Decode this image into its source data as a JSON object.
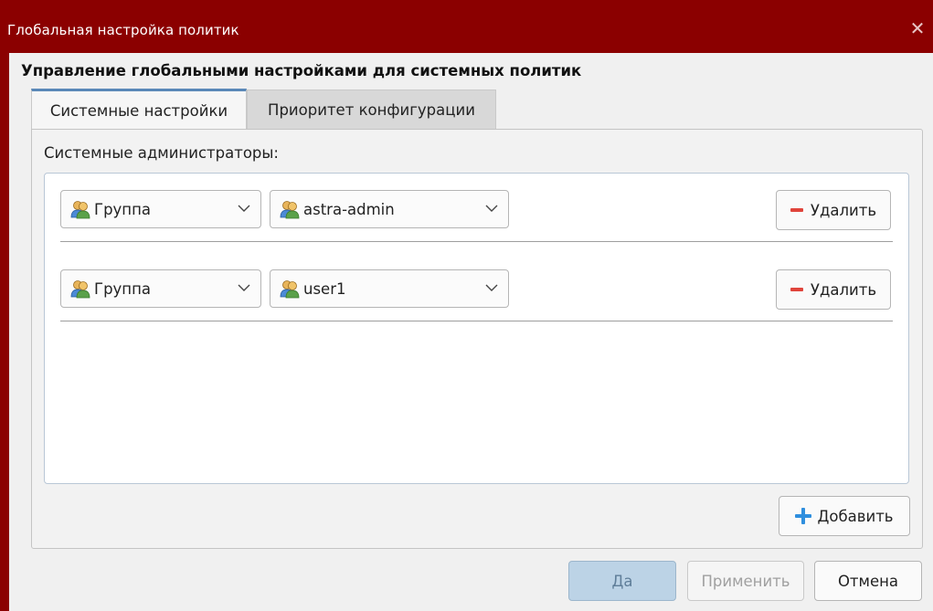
{
  "window": {
    "title": "Глобальная настройка политик",
    "close_icon": "close-icon"
  },
  "heading": "Управление глобальными настройками для системных политик",
  "tabs": [
    {
      "label": "Системные настройки",
      "active": true
    },
    {
      "label": "Приоритет конфигурации",
      "active": false
    }
  ],
  "section_label": "Системные администраторы:",
  "entries": [
    {
      "type": "Группа",
      "name": "astra-admin",
      "type_icon": "group-icon",
      "name_icon": "group-icon",
      "delete_label": "Удалить"
    },
    {
      "type": "Группа",
      "name": "user1",
      "type_icon": "group-icon",
      "name_icon": "group-icon",
      "delete_label": "Удалить"
    }
  ],
  "add_label": "Добавить",
  "footer": {
    "ok_label": "Да",
    "apply_label": "Применить",
    "cancel_label": "Отмена"
  },
  "colors": {
    "titlebar": "#8b0000",
    "delete_accent": "#e0443b",
    "add_accent": "#2f8fde",
    "active_tab_accent": "#5a88b8"
  }
}
